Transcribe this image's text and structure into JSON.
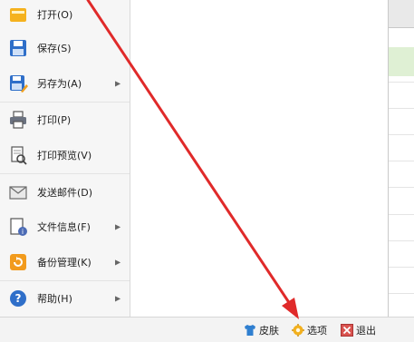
{
  "menu": {
    "items": [
      {
        "label": "打开(O)",
        "icon": "folder-icon",
        "submenu": false
      },
      {
        "label": "保存(S)",
        "icon": "floppy-disk-icon",
        "submenu": false
      },
      {
        "label": "另存为(A)",
        "icon": "save-as-icon",
        "submenu": true
      },
      {
        "label": "打印(P)",
        "icon": "printer-icon",
        "submenu": false
      },
      {
        "label": "打印预览(V)",
        "icon": "print-preview-icon",
        "submenu": false
      },
      {
        "label": "发送邮件(D)",
        "icon": "envelope-icon",
        "submenu": false
      },
      {
        "label": "文件信息(F)",
        "icon": "file-info-icon",
        "submenu": true
      },
      {
        "label": "备份管理(K)",
        "icon": "backup-icon",
        "submenu": true
      },
      {
        "label": "帮助(H)",
        "icon": "help-icon",
        "submenu": true
      }
    ]
  },
  "bottom_bar": {
    "skin_label": "皮肤",
    "options_label": "选项",
    "exit_label": "退出"
  },
  "colors": {
    "annotation_arrow": "#e02a2a",
    "menu_background": "#f6f6f6",
    "sheet_highlight": "#dff0d4"
  }
}
